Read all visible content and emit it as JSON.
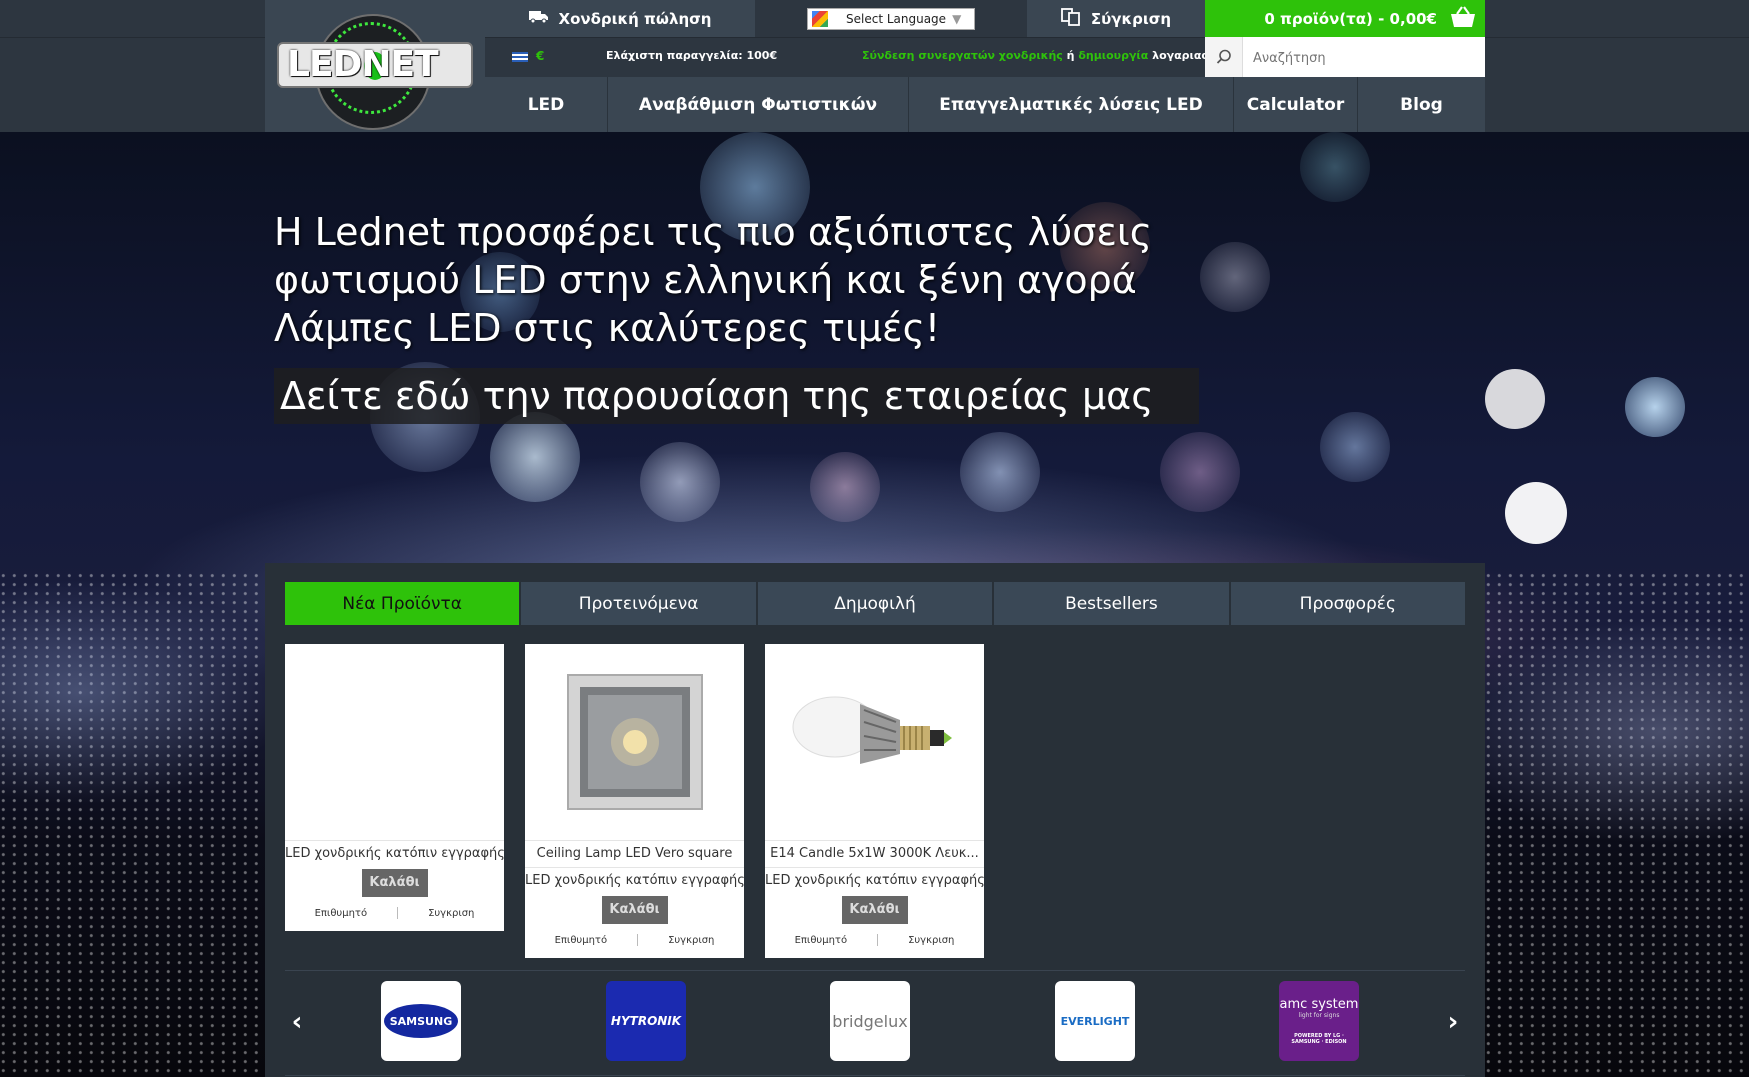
{
  "header": {
    "logo_text": "LEDNET",
    "wholesale_label": "Χονδρική πώληση",
    "language_label": "Select Language",
    "language_arrow": "▼",
    "compare_label": "Σύγκριση",
    "cart_label": "0 προϊόν(τα) - 0,00€",
    "currency_symbol": "€",
    "min_order": "Ελάχιστη παραγγελία: 100€",
    "partner_link": "Σύνδεση συνεργατών χονδρικής",
    "partner_or": " ή ",
    "partner_create": "δημιουργία",
    "partner_suffix": " λογαριασμού.",
    "search_placeholder": "Αναζήτηση"
  },
  "nav": {
    "items": [
      {
        "label": "LED"
      },
      {
        "label": "Αναβάθμιση Φωτιστικών"
      },
      {
        "label": "Επαγγελματικές λύσεις LED"
      },
      {
        "label": "Calculator"
      },
      {
        "label": "Blog"
      }
    ]
  },
  "hero": {
    "line1": "Η Lednet προσφέρει τις πιο αξιόπιστες λύσεις",
    "line2": "φωτισμού LED στην ελληνική και ξένη αγορά",
    "line3": "Λάμπες LED στις καλύτερες τιμές!",
    "cta": "Δείτε εδώ την παρουσίαση της εταιρείας μας"
  },
  "tabs": [
    {
      "label": "Νέα Προϊόντα",
      "active": true
    },
    {
      "label": "Προτεινόμενα"
    },
    {
      "label": "Δημοφιλή"
    },
    {
      "label": "Bestsellers"
    },
    {
      "label": "Προσφορές"
    }
  ],
  "products": [
    {
      "name": "",
      "login_note": "LED χονδρικής κατόπιν εγγραφής",
      "cart": "Καλάθι",
      "wishlist": "Επιθυμητό",
      "compare": "Συγκριση"
    },
    {
      "name": "Ceiling Lamp LED Vero square",
      "login_note": "LED χονδρικής κατόπιν εγγραφής",
      "cart": "Καλάθι",
      "wishlist": "Επιθυμητό",
      "compare": "Συγκριση"
    },
    {
      "name": "E14 Candle 5x1W 3000K Λευκ...",
      "login_note": "LED χονδρικής κατόπιν εγγραφής",
      "cart": "Καλάθι",
      "wishlist": "Επιθυμητό",
      "compare": "Συγκριση"
    }
  ],
  "brands": [
    {
      "name": "SAMSUNG"
    },
    {
      "name": "HYTRONIK"
    },
    {
      "name": "bridgelux"
    },
    {
      "name": "EVERLIGHT"
    },
    {
      "name": "amc system",
      "tagline": "light for signs",
      "powered": "POWERED BY LG · SAMSUNG · EDISON"
    }
  ],
  "colors": {
    "accent_green": "#2ec20a",
    "header_bg": "#2d3640",
    "nav_bg": "#3a4652",
    "panel_bg": "#283038"
  }
}
